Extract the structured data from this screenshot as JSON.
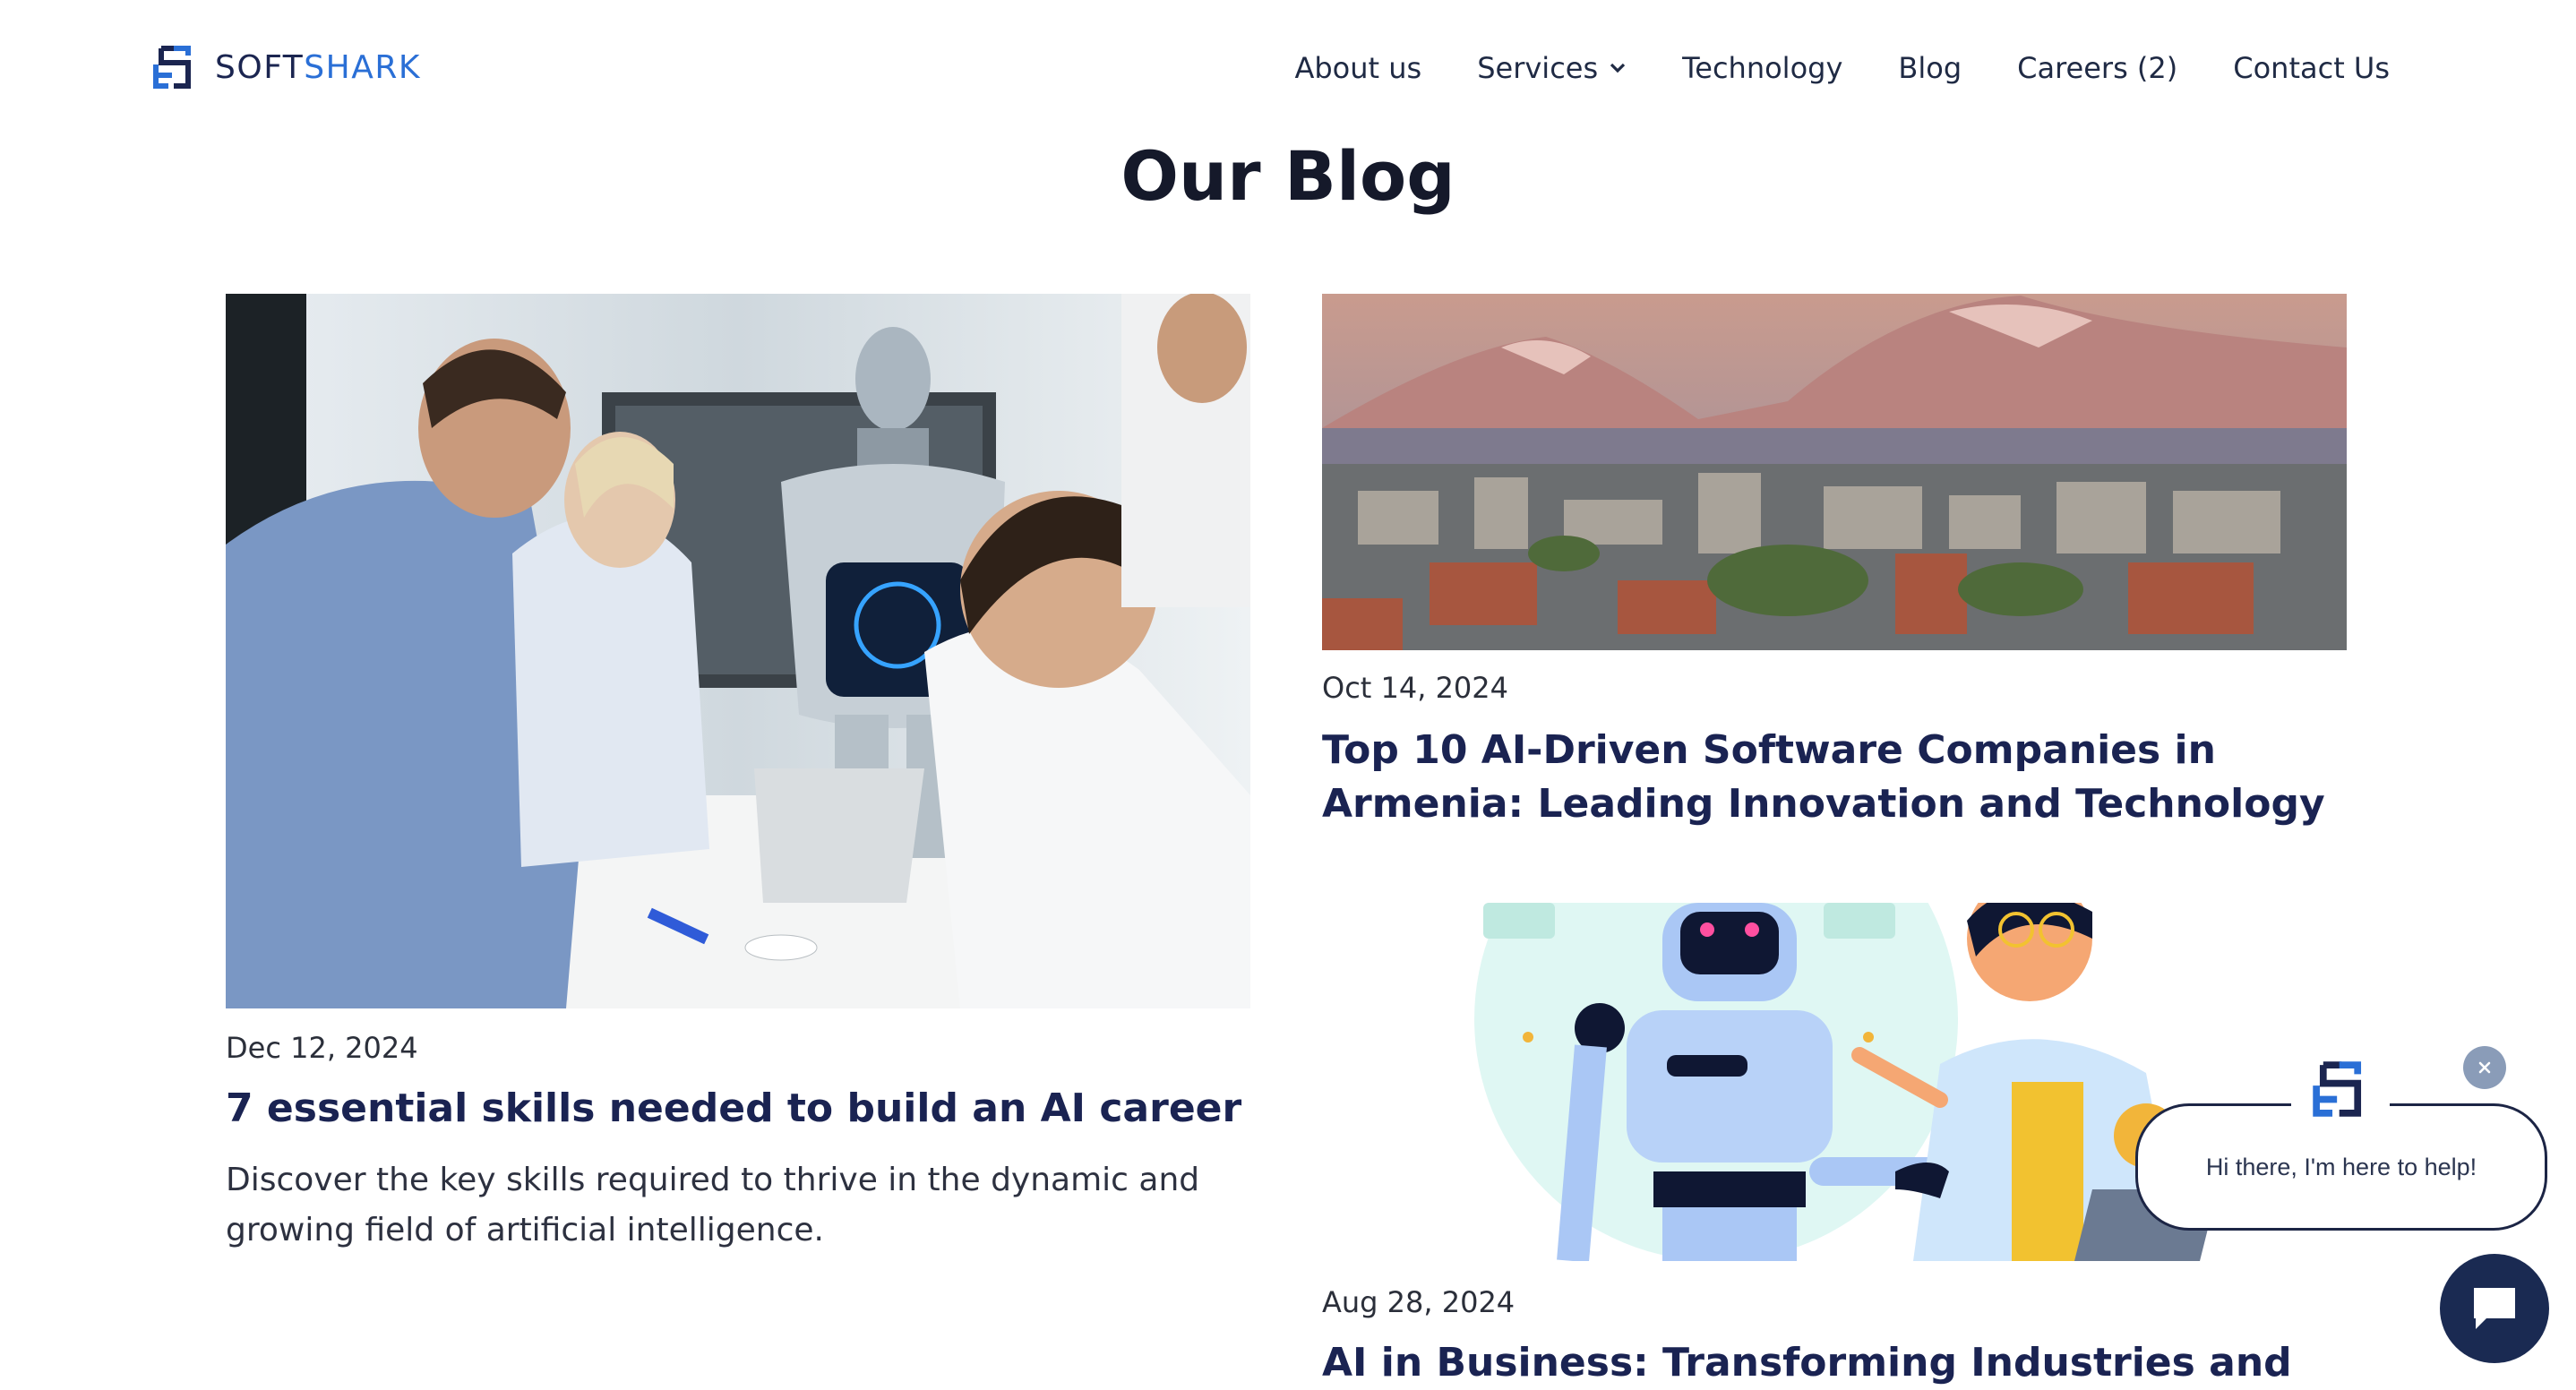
{
  "brand": {
    "name_part1": "SOFT",
    "name_part2": "SHARK",
    "colors": {
      "navy": "#1b2550",
      "blue": "#2a6fd6"
    }
  },
  "nav": {
    "items": [
      {
        "label": "About us"
      },
      {
        "label": "Services",
        "has_dropdown": true,
        "icon": "chevron-down-icon"
      },
      {
        "label": "Technology"
      },
      {
        "label": "Blog"
      },
      {
        "label": "Careers (2)"
      },
      {
        "label": "Contact Us"
      }
    ]
  },
  "page": {
    "title": "Our Blog"
  },
  "posts": [
    {
      "date": "Dec 12, 2024",
      "title": "7 essential skills needed to build an AI career",
      "excerpt": "Discover the key skills required to thrive in the dynamic and growing field of artificial intelligence.",
      "image": "photo of office team with humanoid robot"
    },
    {
      "date": "Oct 14, 2024",
      "title": "Top 10 AI-Driven Software Companies in Armenia: Leading Innovation and Technology",
      "image": "photo of city skyline with snowy mountain"
    },
    {
      "date": "Aug 28, 2024",
      "title": "AI in Business: Transforming Industries and",
      "image": "illustration of robot shaking hands with businessman"
    }
  ],
  "chat": {
    "greeting": "Hi there, I'm here to help!",
    "close_icon": "close-icon",
    "launcher_icon": "chat-bubble-icon",
    "accent": "#1a2a52"
  }
}
